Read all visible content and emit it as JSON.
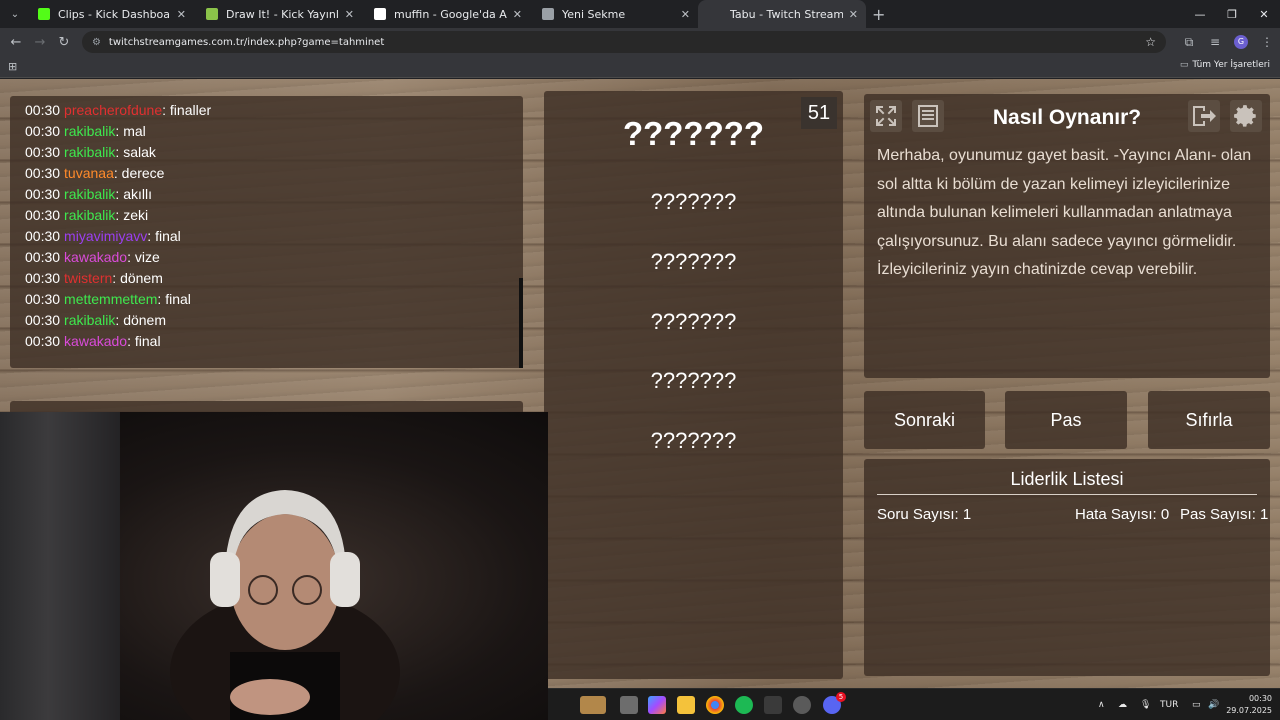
{
  "browser": {
    "tabs": [
      {
        "title": "Clips - Kick Dashboard",
        "color": "#53fc18",
        "active": false
      },
      {
        "title": "Draw It! - Kick Yayınları İçin Çizi",
        "color": "#8bc34a",
        "active": false
      },
      {
        "title": "muffin - Google'da Ara",
        "color": "#ffffff",
        "active": false
      },
      {
        "title": "Yeni Sekme",
        "color": "#9aa0a6",
        "active": false
      },
      {
        "title": "Tabu - Twitch Stream Games",
        "color": "#35363a",
        "active": true
      }
    ],
    "url": "twitchstreamgames.com.tr/index.php?game=tahminet",
    "bookmarks_all": "Tüm Yer İşaretleri",
    "profile_initial": "G"
  },
  "chat": {
    "messages": [
      {
        "time": "00:30",
        "user": "preacherofdune",
        "color": "#e03030",
        "text": "finaller"
      },
      {
        "time": "00:30",
        "user": "rakibalik",
        "color": "#3ee84e",
        "text": "mal"
      },
      {
        "time": "00:30",
        "user": "rakibalik",
        "color": "#3ee84e",
        "text": "salak"
      },
      {
        "time": "00:30",
        "user": "tuvanaa",
        "color": "#ff8a2a",
        "text": "derece"
      },
      {
        "time": "00:30",
        "user": "rakibalik",
        "color": "#3ee84e",
        "text": "akıllı"
      },
      {
        "time": "00:30",
        "user": "rakibalik",
        "color": "#3ee84e",
        "text": "zeki"
      },
      {
        "time": "00:30",
        "user": "miyavimiyavv",
        "color": "#9b3ff0",
        "text": "final"
      },
      {
        "time": "00:30",
        "user": "kawakado",
        "color": "#d94bd9",
        "text": "vize"
      },
      {
        "time": "00:30",
        "user": "twistern",
        "color": "#e03030",
        "text": "dönem"
      },
      {
        "time": "00:30",
        "user": "mettemmettem",
        "color": "#3ee84e",
        "text": "final"
      },
      {
        "time": "00:30",
        "user": "rakibalik",
        "color": "#3ee84e",
        "text": "dönem"
      },
      {
        "time": "00:30",
        "user": "kawakado",
        "color": "#d94bd9",
        "text": "final"
      }
    ]
  },
  "game": {
    "counter": "51",
    "main_word": "???????",
    "taboo_words": [
      "???????",
      "???????",
      "???????",
      "???????",
      "???????"
    ]
  },
  "how_to": {
    "title": "Nasıl Oynanır?",
    "text": "Merhaba, oyunumuz gayet basit. -Yayıncı Alanı- olan sol altta ki bölüm de yazan kelimeyi izleyicilerinize altında bulunan kelimeleri kullanmadan anlatmaya çalışıyorsunuz. Bu alanı sadece yayıncı görmelidir. İzleyicileriniz yayın chatinizde cevap verebilir."
  },
  "buttons": {
    "next": "Sonraki",
    "pass": "Pas",
    "reset": "Sıfırla"
  },
  "leaderboard": {
    "title": "Liderlik Listesi",
    "questions": "Soru Sayısı: 1",
    "errors": "Hata Sayısı: 0",
    "passes": "Pas Sayısı: 1"
  },
  "taskbar": {
    "language": "TUR",
    "time": "00:30",
    "date": "29.07.2025",
    "discord_badge": "5"
  }
}
